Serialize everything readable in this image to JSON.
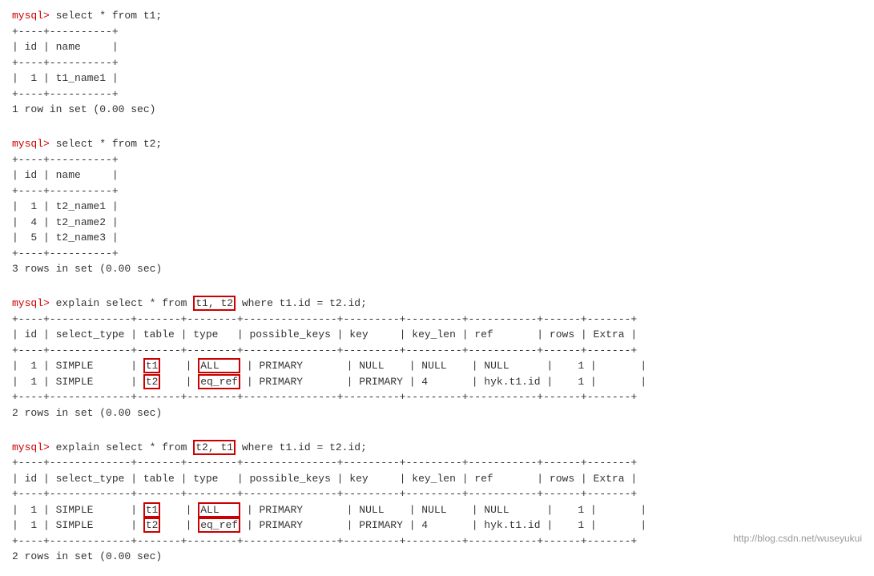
{
  "terminal": {
    "sections": [
      {
        "id": "t1-query",
        "prompt_line": "mysql> select * from t1;",
        "table_lines": [
          "+----+----------+",
          "| id | name     |",
          "+----+----------+",
          "|  1 | t1_name1 |",
          "+----+----------+"
        ],
        "result_line": "1 row in set (0.00 sec)"
      },
      {
        "id": "t2-query",
        "prompt_line": "mysql> select * from t2;",
        "table_lines": [
          "+----+----------+",
          "| id | name     |",
          "+----+----------+",
          "|  1 | t2_name1 |",
          "|  4 | t2_name2 |",
          "|  5 | t2_name3 |",
          "+----+----------+"
        ],
        "result_line": "3 rows in set (0.00 sec)"
      },
      {
        "id": "explain1",
        "prompt_prefix": "mysql> explain select * from ",
        "prompt_highlight": "t1, t2",
        "prompt_suffix": " where t1.id = t2.id;",
        "table_header_border": "+----+-------------+-------+--------+---------------+---------+---------+-----------+------+-------+",
        "table_header": "| id | select_type | table | type   | possible_keys | key     | key_len | ref       | rows | Extra |",
        "table_header_border2": "+----+-------------+-------+--------+---------------+---------+---------+-----------+------+-------+",
        "rows": [
          {
            "id": "1",
            "select_type": "SIMPLE",
            "table_val": "t1",
            "table_highlight": true,
            "type_val": "ALL",
            "type_highlight": true,
            "possible_keys": "PRIMARY",
            "key": "NULL",
            "key_len": "NULL",
            "ref": "NULL",
            "rows": "1",
            "extra": ""
          },
          {
            "id": "1",
            "select_type": "SIMPLE",
            "table_val": "t2",
            "table_highlight": true,
            "type_val": "eq_ref",
            "type_highlight": true,
            "possible_keys": "PRIMARY",
            "key": "PRIMARY",
            "key_len": "4",
            "ref": "hyk.t1.id",
            "rows": "1",
            "extra": ""
          }
        ],
        "table_footer": "+----+-------------+-------+--------+---------------+---------+---------+-----------+------+-------+",
        "result_line": "2 rows in set (0.00 sec)"
      },
      {
        "id": "explain2",
        "prompt_prefix": "mysql> explain select * from ",
        "prompt_highlight": "t2, t1",
        "prompt_suffix": " where t1.id = t2.id;",
        "table_header_border": "+----+-------------+-------+--------+---------------+---------+---------+-----------+------+-------+",
        "table_header": "| id | select_type | table | type   | possible_keys | key     | key_len | ref       | rows | Extra |",
        "table_header_border2": "+----+-------------+-------+--------+---------------+---------+---------+-----------+------+-------+",
        "rows": [
          {
            "id": "1",
            "select_type": "SIMPLE",
            "table_val": "t1",
            "table_highlight": true,
            "type_val": "ALL",
            "type_highlight": true,
            "possible_keys": "PRIMARY",
            "key": "NULL",
            "key_len": "NULL",
            "ref": "NULL",
            "rows": "1",
            "extra": ""
          },
          {
            "id": "1",
            "select_type": "SIMPLE",
            "table_val": "t2",
            "table_highlight": true,
            "type_val": "eq_ref",
            "type_highlight": true,
            "possible_keys": "PRIMARY",
            "key": "PRIMARY",
            "key_len": "4",
            "ref": "hyk.t1.id",
            "rows": "1",
            "extra": ""
          }
        ],
        "table_footer": "+----+-------------+-------+--------+---------------+---------+---------+-----------+------+-------+",
        "result_line": "2 rows in set (0.00 sec)"
      }
    ],
    "watermark": "http://blog.csdn.net/wuseyukui"
  }
}
